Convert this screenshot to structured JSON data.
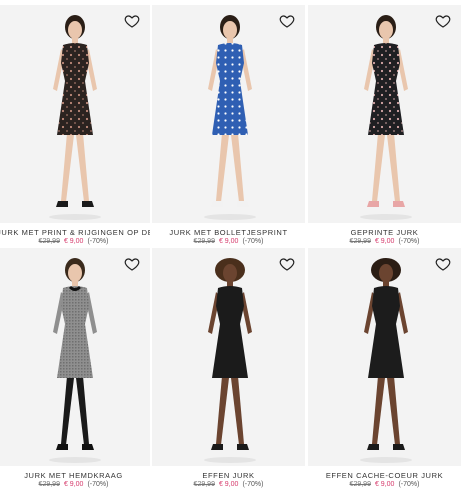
{
  "products": [
    {
      "title": "JURK MET PRINT & RIJGINGEN OP DE RUG",
      "old_price": "€29,99",
      "new_price": "€ 9,00",
      "discount": "(-70%)",
      "dress_color": "#2b2320",
      "pattern_color": "#c08a7a",
      "hair_color": "#2a1e16",
      "skin_color": "#e9c6ad",
      "shoe_color": "#1a1a1a",
      "icon": "heart-icon"
    },
    {
      "title": "JURK MET BOLLETJESPRINT",
      "old_price": "€29,99",
      "new_price": "€ 9,00",
      "discount": "(-70%)",
      "dress_color": "#2f5fb3",
      "pattern_color": "#ffffff",
      "hair_color": "#2a1e16",
      "skin_color": "#e9c6ad",
      "shoe_color": "#f2f2f2",
      "icon": "heart-icon"
    },
    {
      "title": "GEPRINTE JURK",
      "old_price": "€29,99",
      "new_price": "€ 9,00",
      "discount": "(-70%)",
      "dress_color": "#1f1f22",
      "pattern_color": "#d9a9a9",
      "hair_color": "#2a1e16",
      "skin_color": "#e9c6ad",
      "shoe_color": "#e8a6a6",
      "icon": "heart-icon"
    },
    {
      "title": "JURK MET HEMDKRAAG",
      "old_price": "€29,99",
      "new_price": "€ 9,00",
      "discount": "(-70%)",
      "dress_color": "#8f8f8f",
      "pattern_color": "#6f6f6f",
      "hair_color": "#3a2a1c",
      "skin_color": "#e9c6ad",
      "shoe_color": "#111111",
      "icon": "heart-icon"
    },
    {
      "title": "EFFEN JURK",
      "old_price": "€29,99",
      "new_price": "€ 9,00",
      "discount": "(-70%)",
      "dress_color": "#1b1b1b",
      "pattern_color": "#1b1b1b",
      "hair_color": "#4a2f1c",
      "skin_color": "#6b4430",
      "shoe_color": "#1a1a1a",
      "icon": "heart-icon"
    },
    {
      "title": "EFFEN CACHE-COEUR JURK",
      "old_price": "€29,99",
      "new_price": "€ 9,00",
      "discount": "(-70%)",
      "dress_color": "#1c1c1c",
      "pattern_color": "#1c1c1c",
      "hair_color": "#2b1d14",
      "skin_color": "#6b4430",
      "shoe_color": "#1a1a1a",
      "icon": "heart-icon"
    }
  ]
}
